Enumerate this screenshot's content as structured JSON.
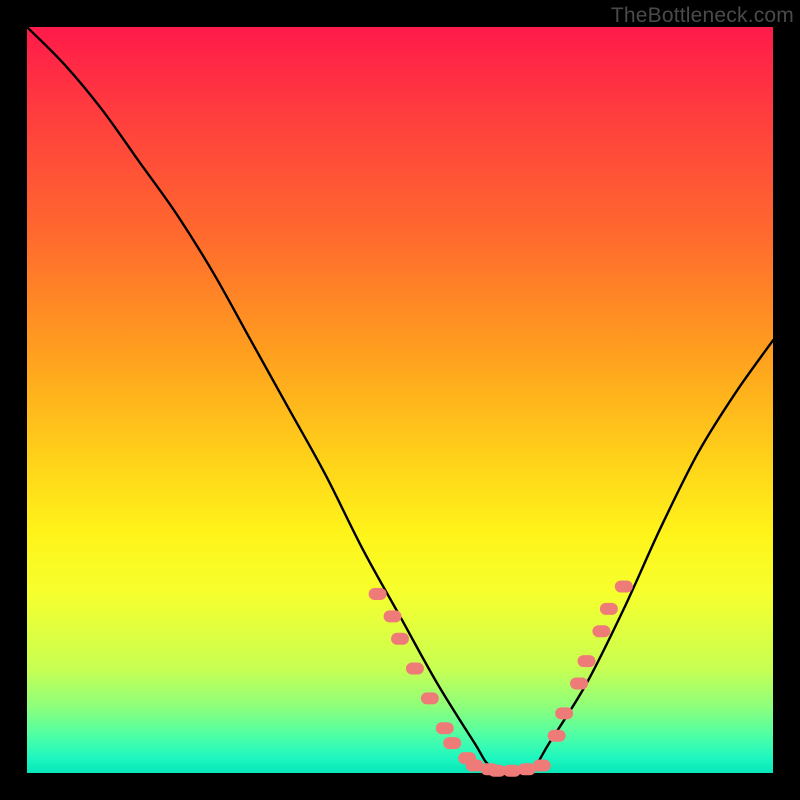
{
  "watermark": {
    "text": "TheBottleneck.com"
  },
  "chart_data": {
    "type": "line",
    "title": "",
    "xlabel": "",
    "ylabel": "",
    "xlim": [
      0,
      100
    ],
    "ylim": [
      0,
      100
    ],
    "background_gradient": "green (bottom) → red (top), value = bottleneck severity",
    "series": [
      {
        "name": "bottleneck-curve",
        "x": [
          0,
          5,
          10,
          15,
          20,
          25,
          30,
          35,
          40,
          45,
          50,
          55,
          60,
          62,
          65,
          68,
          70,
          75,
          80,
          85,
          90,
          95,
          100
        ],
        "y": [
          100,
          95,
          89,
          82,
          75,
          67,
          58,
          49,
          40,
          30,
          21,
          12,
          4,
          1,
          0,
          1,
          4,
          12,
          22,
          33,
          43,
          51,
          58
        ]
      },
      {
        "name": "highlight-dots-left",
        "x": [
          47,
          49,
          50,
          52,
          54,
          56,
          57,
          59
        ],
        "y": [
          24,
          21,
          18,
          14,
          10,
          6,
          4,
          2
        ]
      },
      {
        "name": "highlight-dots-bottom",
        "x": [
          60,
          62,
          63,
          65,
          67,
          69
        ],
        "y": [
          1,
          0.5,
          0.3,
          0.3,
          0.5,
          1
        ]
      },
      {
        "name": "highlight-dots-right",
        "x": [
          71,
          72,
          74,
          75,
          77,
          78,
          80
        ],
        "y": [
          5,
          8,
          12,
          15,
          19,
          22,
          25
        ]
      }
    ]
  }
}
